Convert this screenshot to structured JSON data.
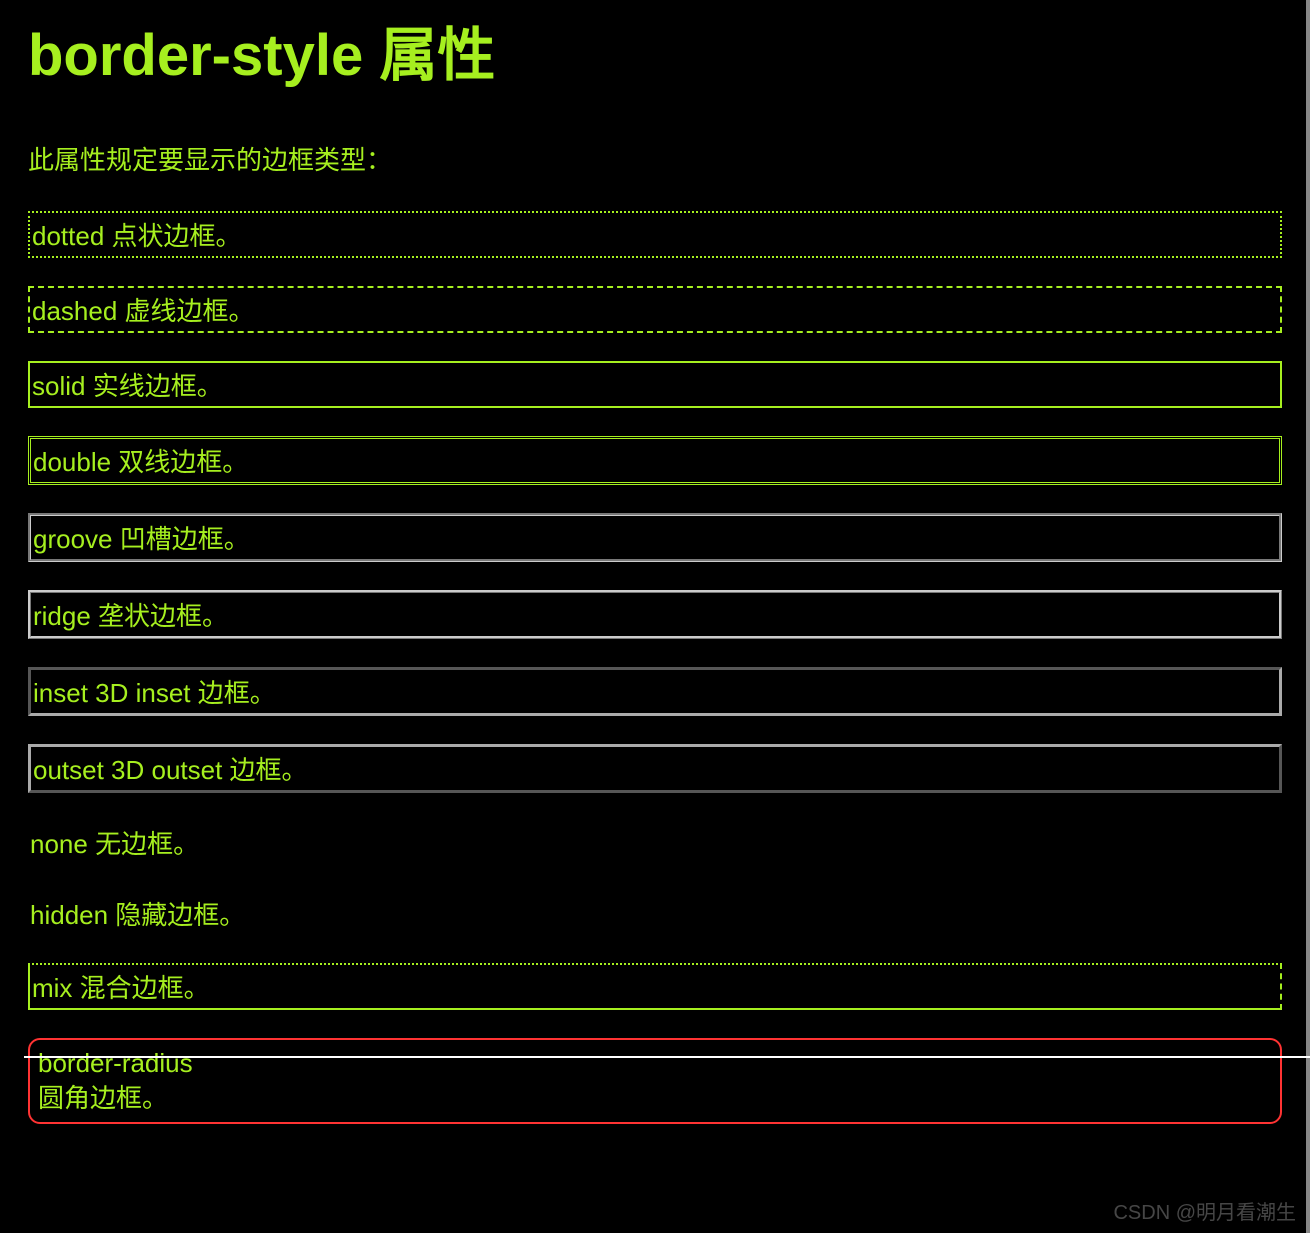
{
  "heading": "border-style 属性",
  "subtitle": "此属性规定要显示的边框类型：",
  "items": {
    "dotted": "dotted 点状边框。",
    "dashed": "dashed 虚线边框。",
    "solid": "solid 实线边框。",
    "double": "double 双线边框。",
    "groove": "groove 凹槽边框。",
    "ridge": "ridge 垄状边框。",
    "inset": "inset 3D inset 边框。",
    "outset": "outset 3D outset 边框。",
    "none": "none 无边框。",
    "hidden": "hidden 隐藏边框。",
    "mix": "mix 混合边框。",
    "radius": "border-radius\n圆角边框。"
  },
  "watermark": "CSDN @明月看潮生"
}
